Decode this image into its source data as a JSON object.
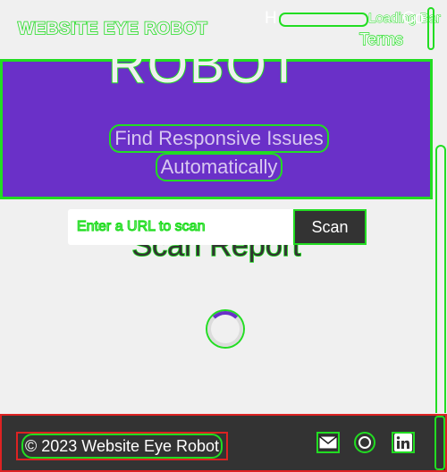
{
  "header": {
    "logo": "WEBSITE EYE ROBOT",
    "nav": {
      "link1": "H",
      "link2": "Loading Bar",
      "link3": "Co",
      "link4": "Terms"
    }
  },
  "hero": {
    "title": "ROBOT",
    "subtitle_line1": "Find Responsive Issues",
    "subtitle_line2": "Automatically"
  },
  "scan": {
    "placeholder": "Enter a URL to scan",
    "button_label": "Scan"
  },
  "report": {
    "title": "Scan Report"
  },
  "footer": {
    "copyright": "© 2023 Website Eye Robot",
    "icons": [
      "mail-icon",
      "chat-icon",
      "linkedin-icon"
    ]
  },
  "colors": {
    "accent": "#6a30c8",
    "footer_bg": "#333333",
    "page_bg": "#f0f0f0",
    "outline_debug": "#22dd22",
    "outline_error": "#dd2222"
  }
}
